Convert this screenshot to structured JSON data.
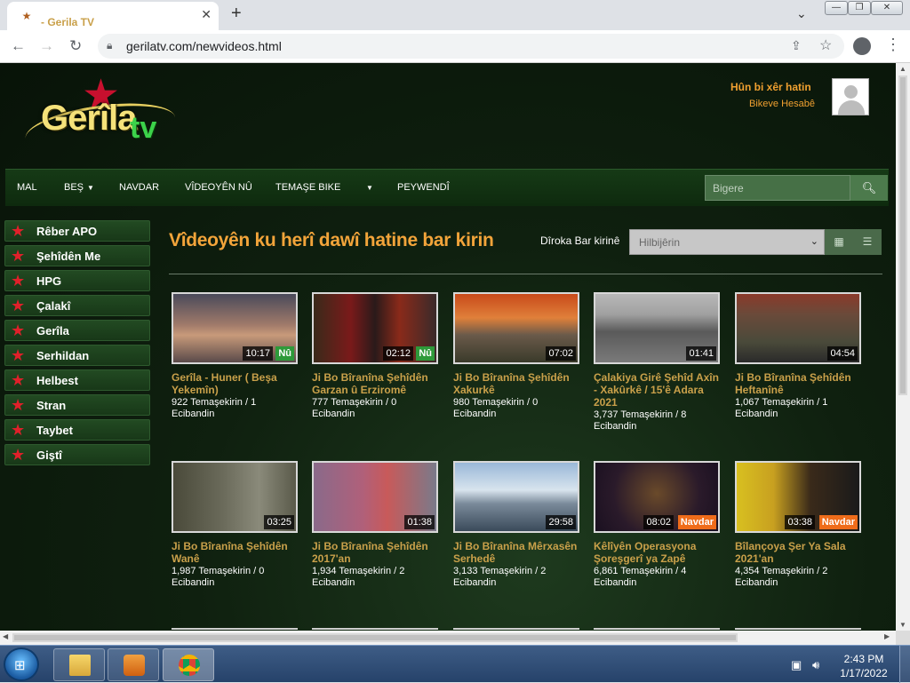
{
  "browser": {
    "tab_title": "- Gerila TV",
    "url": "gerilatv.com/newvideos.html"
  },
  "header": {
    "logo_text": "Gerîlatv",
    "login_title": "Hûn bi xêr hatin",
    "login_link": "Bikeve Hesabê"
  },
  "nav": {
    "items": [
      "MAL",
      "BEŞ",
      "NAVDAR",
      "VÎDEOYÊN NÛ",
      "TEMAŞE BIKE",
      "",
      "PEYWENDÎ"
    ],
    "search_placeholder": "Bigere"
  },
  "sidebar": {
    "items": [
      "Rêber APO",
      "Şehîdên Me",
      "HPG",
      "Çalakî",
      "Gerîla",
      "Serhildan",
      "Helbest",
      "Stran",
      "Taybet",
      "Giştî"
    ]
  },
  "main": {
    "title": "Vîdeoyên ku herî dawî hatine bar kirin",
    "sort_label": "Dîroka Bar kirinê",
    "sort_value": "Hilbijêrin"
  },
  "videos": [
    {
      "title": "Gerîla - Huner ( Beşa Yekemîn)",
      "meta": "922 Temaşekirin / 1 Ecibandin",
      "duration": "10:17",
      "badge": "Nû"
    },
    {
      "title": "Ji Bo Bîranîna Şehîdên Garzan û Erziromê",
      "meta": "777 Temaşekirin / 0 Ecibandin",
      "duration": "02:12",
      "badge": "Nû"
    },
    {
      "title": "Ji Bo Bîranîna Şehîdên Xakurkê",
      "meta": "980 Temaşekirin / 0 Ecibandin",
      "duration": "07:02",
      "badge": ""
    },
    {
      "title": "Çalakiya Girê Şehîd Axîn - Xakûrkê / 15'ê Adara 2021",
      "meta": "3,737 Temaşekirin / 8 Ecibandin",
      "duration": "01:41",
      "badge": ""
    },
    {
      "title": "Ji Bo Bîranîna Şehîdên Heftanînê",
      "meta": "1,067 Temaşekirin / 1 Ecibandin",
      "duration": "04:54",
      "badge": ""
    },
    {
      "title": "Ji Bo Bîranîna Şehîdên Wanê",
      "meta": "1,987 Temaşekirin / 0 Ecibandin",
      "duration": "03:25",
      "badge": ""
    },
    {
      "title": "Ji Bo Bîranîna Şehîdên 2017'an",
      "meta": "1,934 Temaşekirin / 2 Ecibandin",
      "duration": "01:38",
      "badge": ""
    },
    {
      "title": "Ji Bo Bîranîna Mêrxasên Serhedê",
      "meta": "3,133 Temaşekirin / 2 Ecibandin",
      "duration": "29:58",
      "badge": ""
    },
    {
      "title": "Kêlîyên Operasyona Şoreşgerî ya Zapê",
      "meta": "6,861 Temaşekirin / 4 Ecibandin",
      "duration": "08:02",
      "badge": "Navdar"
    },
    {
      "title": "Bîlançoya Şer Ya Sala 2021'an",
      "meta": "4,354 Temaşekirin / 2 Ecibandin",
      "duration": "03:38",
      "badge": "Navdar"
    }
  ],
  "taskbar": {
    "time": "2:43 PM",
    "date": "1/17/2022"
  },
  "icons": {
    "back": "arrow-left-icon",
    "forward": "arrow-right-icon",
    "reload": "reload-icon",
    "lock": "lock-icon",
    "search": "search-icon",
    "star": "star-icon",
    "grid": "grid-view-icon",
    "list": "list-view-icon"
  },
  "colors": {
    "accent": "#f2a43a",
    "title_gold": "#c9a04a",
    "badge_new": "#2e9a3a",
    "badge_popular": "#ef6c1a",
    "sidebar_star": "#e0202a"
  }
}
